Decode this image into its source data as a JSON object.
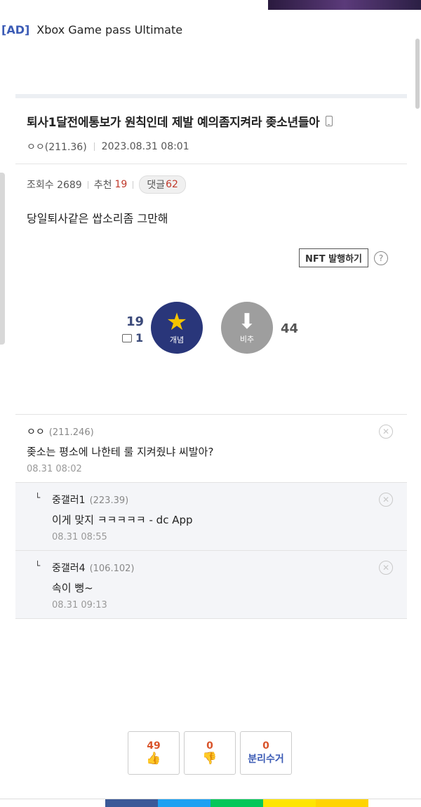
{
  "ad": {
    "tag": "[AD]",
    "title": "Xbox Game pass Ultimate"
  },
  "post": {
    "title": "퇴사1달전에통보가 원칙인데 제발 예의좀지켜라 좆소년들아",
    "author": "ㅇㅇ(211.36)",
    "datetime": "2023.08.31 08:01",
    "views_label": "조회수 2689",
    "recommend_label": "추천",
    "recommend_count": "19",
    "comments_label": "댓글",
    "comments_count": "62",
    "body": "당일퇴사같은 쌉소리좀 그만해"
  },
  "nft": {
    "label": "NFT 발행하기",
    "help": "?"
  },
  "votes": {
    "up_count": "19",
    "sub_count": "1",
    "up_label": "개념",
    "down_label": "비추",
    "down_count": "44"
  },
  "comments": [
    {
      "name": "ㅇㅇ",
      "ip": "(211.246)",
      "text": "좆소는 평소에 나한테 룰 지켜줬냐 씨발아?",
      "date": "08.31 08:02"
    },
    {
      "name": "중갤러1",
      "ip": "(223.39)",
      "text": "이게 맞지 ㅋㅋㅋㅋㅋ - dc App",
      "date": "08.31 08:55"
    },
    {
      "name": "중갤러4",
      "ip": "(106.102)",
      "text": "속이 뻥~",
      "date": "08.31 09:13"
    }
  ],
  "bottom_votes": {
    "like": "49",
    "dislike": "0",
    "recycle_count": "0",
    "recycle_label": "분리수거"
  },
  "colors": {
    "accent": "#29367a",
    "link": "#3b5bb5",
    "red": "#c0392b",
    "orange": "#d9542b"
  },
  "icons": {
    "star": "star-icon",
    "down": "arrow-down-icon",
    "thumbs_up": "thumbs-up-icon",
    "thumbs_down": "thumbs-down-icon",
    "close": "close-icon"
  }
}
